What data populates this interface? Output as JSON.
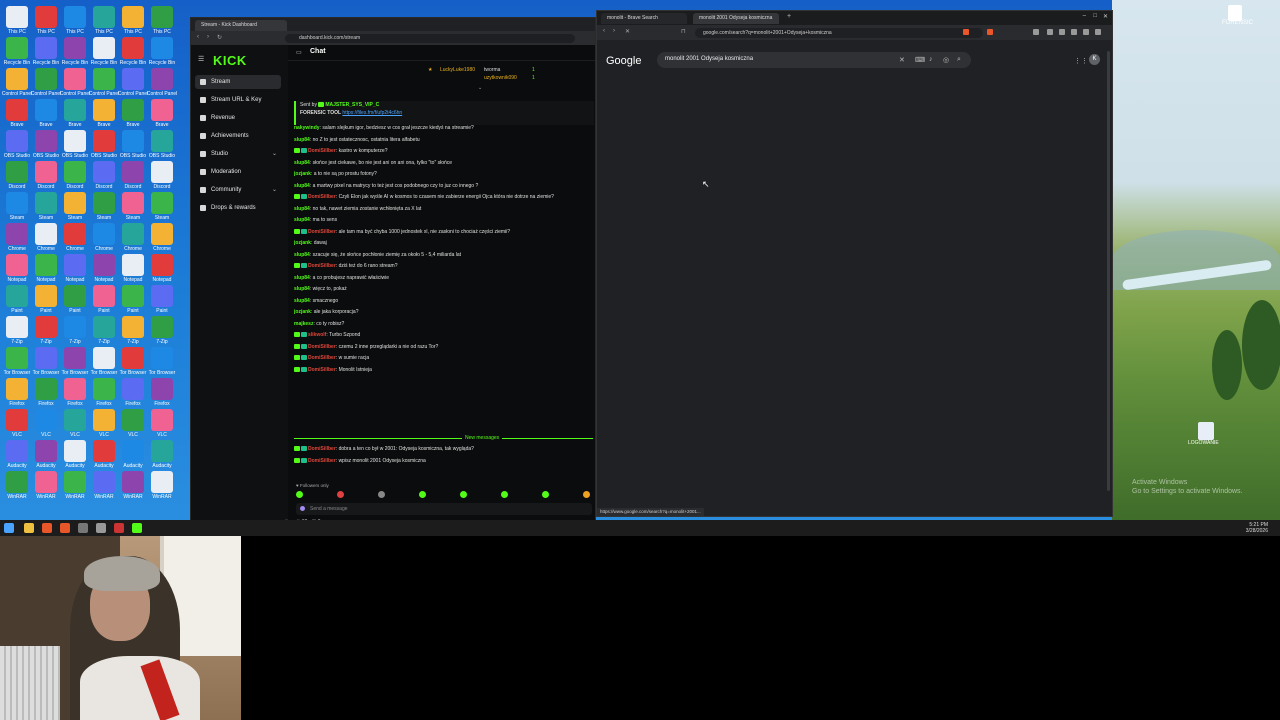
{
  "desktop": {
    "icon_labels": [
      "This PC",
      "Recycle Bin",
      "Control Panel",
      "Brave",
      "OBS Studio",
      "Discord",
      "Steam",
      "Chrome",
      "Notepad",
      "Paint",
      "7-Zip",
      "Tor Browser",
      "Firefox",
      "VLC",
      "Audacity",
      "WinRAR"
    ],
    "right_icon_label": "FORENSIC",
    "right_icon2_label": "LOGOWANIE",
    "activate_windows_title": "Activate Windows",
    "activate_windows_sub": "Go to Settings to activate Windows."
  },
  "taskbar": {
    "time": "5:21 PM",
    "date": "3/28/2026"
  },
  "kick": {
    "tab_title": "Stream - Kick Dashboard",
    "url": "dashboard.kick.com/stream",
    "logo": "KICK",
    "sidebar": [
      {
        "label": "Stream",
        "active": true
      },
      {
        "label": "Stream URL & Key"
      },
      {
        "label": "Revenue"
      },
      {
        "label": "Achievements"
      },
      {
        "label": "Studio",
        "chevron": "⌄"
      },
      {
        "label": "Moderation"
      },
      {
        "label": "Community",
        "chevron": "⌄"
      },
      {
        "label": "Drops & rewards"
      }
    ],
    "chat_title": "Chat",
    "leaderboard": [
      {
        "name": "LuckyLuke1980",
        "value": "1"
      },
      {
        "name": "tworma",
        "value": "1"
      },
      {
        "name": "uzytkownik090",
        "value": "1"
      }
    ],
    "pinned": {
      "label": "Sent by",
      "user": "MAJSTER_SYS_VIP_C",
      "prefix": "FORENSIC TOOL",
      "link": "https://files.fm/f/ufp2t4c6hn"
    },
    "messages": [
      {
        "user": "nakywindy",
        "text": "salam slejkum igor, bedziesz w cos grał jeszcze kiedyś na streamie?"
      },
      {
        "user": "slup84",
        "text": "no Z to jest ostatecznosc, ostatnia litera alfabetu"
      },
      {
        "user": "DomiSillber",
        "text": "kastro w komputerze?",
        "badged": true
      },
      {
        "user": "slup84",
        "text": "słońce jest ciekawe, bo nie jest ani on ani ona, tylko \"to\" słońce"
      },
      {
        "user": "jozjank",
        "text": "a to nie są po prostu fotony?"
      },
      {
        "user": "slup84",
        "text": "a martwy pixel na matrycy to też jest cos podobnego czy to juz co innego ?"
      },
      {
        "user": "DomiSillber",
        "text": "Czyli Elon jak wyśle AI w kosmos to czasem nie zabierze energii Ojca która nie dotrze na ziemie?",
        "badged": true
      },
      {
        "user": "slup84",
        "text": "no tak, nawet ziemia zostanie wchłonięta za X lat"
      },
      {
        "user": "slup84",
        "text": "ma to sens"
      },
      {
        "user": "DomiSillber",
        "text": "ale tam ma być chyba 1000 jednostek xl, nie zasłoni to chociaż części ziemii?",
        "badged": true
      },
      {
        "user": "jozjank",
        "text": "dawaj"
      },
      {
        "user": "slup84",
        "text": "szacuje się, że słońce pochłonie ziemię za około 5 - 5,4 miliarda lat"
      },
      {
        "user": "DomiSillber",
        "text": "dziś też do 6 rano stream?",
        "badged": true
      },
      {
        "user": "slup84",
        "text": "a co probujesz naprawić właściwie"
      },
      {
        "user": "slup84",
        "text": "więcz to, pokaż"
      },
      {
        "user": "slup84",
        "text": "smacznego"
      },
      {
        "user": "jozjank",
        "text": "ale jaka korporacja?"
      },
      {
        "user": "majkesz",
        "text": "co ty robisz?"
      },
      {
        "user": "slikwolf",
        "text": "Turbo Szpond",
        "badged": true
      },
      {
        "user": "DomiSillber",
        "text": "czemu 2 inne przeglądarki a nie od razu Tor?",
        "badged": true
      },
      {
        "user": "DomiSillber",
        "text": "w sumie racja",
        "badged": true
      },
      {
        "user": "DomiSillber",
        "text": "Monolit Istnieja",
        "badged": true
      }
    ],
    "new_messages_label": "New messages",
    "new_msgs": [
      {
        "user": "DomiSillber",
        "text": "dobra a ten co był w 2001: Odyseja kosmiczna, tak wygląda?",
        "badged": true
      },
      {
        "user": "DomiSillber",
        "text": "wpisz monolit 2001 Odyseja kosmiczna",
        "badged": true
      }
    ],
    "followers_only": "Followers only",
    "send_placeholder": "Send a message",
    "footer_left": "00",
    "footer_right": "0"
  },
  "browser": {
    "tabs": [
      "monolit - Brave Search",
      "monolit 2001 Odyseja kosmiczna"
    ],
    "url": "google.com/search?q=monolit+2001+Odyseja+kosmiczna",
    "google_label": "Google",
    "search_query": "monolit 2001 Odyseja kosmiczna",
    "account_initial": "K",
    "status_url": "https://www.google.com/search?q=monolit+2001..."
  },
  "colors": {
    "kick_green": "#53fc18",
    "user_red": "#e0473a"
  }
}
